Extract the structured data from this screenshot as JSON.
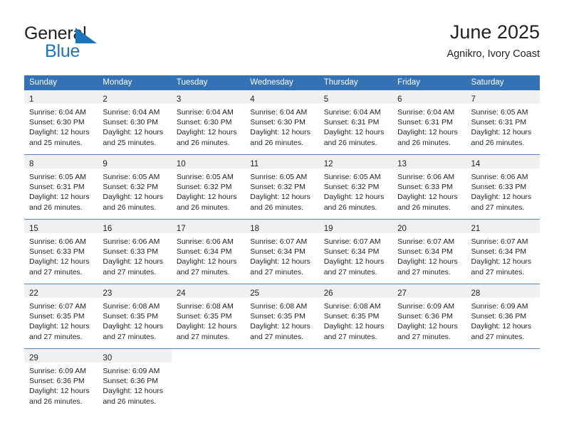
{
  "brand": {
    "name_part1": "General",
    "name_part2": "Blue",
    "flag_color": "#1b75bb"
  },
  "header": {
    "title": "June 2025",
    "subtitle": "Agnikro, Ivory Coast"
  },
  "theme": {
    "header_bg": "#3372b5",
    "daynum_band_bg": "#f0f0f0",
    "grid_line": "#4f85c0",
    "text": "#231f20"
  },
  "weekdays": [
    "Sunday",
    "Monday",
    "Tuesday",
    "Wednesday",
    "Thursday",
    "Friday",
    "Saturday"
  ],
  "weeks": [
    [
      {
        "day": "1",
        "sunrise": "Sunrise: 6:04 AM",
        "sunset": "Sunset: 6:30 PM",
        "daylight1": "Daylight: 12 hours",
        "daylight2": "and 25 minutes."
      },
      {
        "day": "2",
        "sunrise": "Sunrise: 6:04 AM",
        "sunset": "Sunset: 6:30 PM",
        "daylight1": "Daylight: 12 hours",
        "daylight2": "and 25 minutes."
      },
      {
        "day": "3",
        "sunrise": "Sunrise: 6:04 AM",
        "sunset": "Sunset: 6:30 PM",
        "daylight1": "Daylight: 12 hours",
        "daylight2": "and 26 minutes."
      },
      {
        "day": "4",
        "sunrise": "Sunrise: 6:04 AM",
        "sunset": "Sunset: 6:30 PM",
        "daylight1": "Daylight: 12 hours",
        "daylight2": "and 26 minutes."
      },
      {
        "day": "5",
        "sunrise": "Sunrise: 6:04 AM",
        "sunset": "Sunset: 6:31 PM",
        "daylight1": "Daylight: 12 hours",
        "daylight2": "and 26 minutes."
      },
      {
        "day": "6",
        "sunrise": "Sunrise: 6:04 AM",
        "sunset": "Sunset: 6:31 PM",
        "daylight1": "Daylight: 12 hours",
        "daylight2": "and 26 minutes."
      },
      {
        "day": "7",
        "sunrise": "Sunrise: 6:05 AM",
        "sunset": "Sunset: 6:31 PM",
        "daylight1": "Daylight: 12 hours",
        "daylight2": "and 26 minutes."
      }
    ],
    [
      {
        "day": "8",
        "sunrise": "Sunrise: 6:05 AM",
        "sunset": "Sunset: 6:31 PM",
        "daylight1": "Daylight: 12 hours",
        "daylight2": "and 26 minutes."
      },
      {
        "day": "9",
        "sunrise": "Sunrise: 6:05 AM",
        "sunset": "Sunset: 6:32 PM",
        "daylight1": "Daylight: 12 hours",
        "daylight2": "and 26 minutes."
      },
      {
        "day": "10",
        "sunrise": "Sunrise: 6:05 AM",
        "sunset": "Sunset: 6:32 PM",
        "daylight1": "Daylight: 12 hours",
        "daylight2": "and 26 minutes."
      },
      {
        "day": "11",
        "sunrise": "Sunrise: 6:05 AM",
        "sunset": "Sunset: 6:32 PM",
        "daylight1": "Daylight: 12 hours",
        "daylight2": "and 26 minutes."
      },
      {
        "day": "12",
        "sunrise": "Sunrise: 6:05 AM",
        "sunset": "Sunset: 6:32 PM",
        "daylight1": "Daylight: 12 hours",
        "daylight2": "and 26 minutes."
      },
      {
        "day": "13",
        "sunrise": "Sunrise: 6:06 AM",
        "sunset": "Sunset: 6:33 PM",
        "daylight1": "Daylight: 12 hours",
        "daylight2": "and 26 minutes."
      },
      {
        "day": "14",
        "sunrise": "Sunrise: 6:06 AM",
        "sunset": "Sunset: 6:33 PM",
        "daylight1": "Daylight: 12 hours",
        "daylight2": "and 27 minutes."
      }
    ],
    [
      {
        "day": "15",
        "sunrise": "Sunrise: 6:06 AM",
        "sunset": "Sunset: 6:33 PM",
        "daylight1": "Daylight: 12 hours",
        "daylight2": "and 27 minutes."
      },
      {
        "day": "16",
        "sunrise": "Sunrise: 6:06 AM",
        "sunset": "Sunset: 6:33 PM",
        "daylight1": "Daylight: 12 hours",
        "daylight2": "and 27 minutes."
      },
      {
        "day": "17",
        "sunrise": "Sunrise: 6:06 AM",
        "sunset": "Sunset: 6:34 PM",
        "daylight1": "Daylight: 12 hours",
        "daylight2": "and 27 minutes."
      },
      {
        "day": "18",
        "sunrise": "Sunrise: 6:07 AM",
        "sunset": "Sunset: 6:34 PM",
        "daylight1": "Daylight: 12 hours",
        "daylight2": "and 27 minutes."
      },
      {
        "day": "19",
        "sunrise": "Sunrise: 6:07 AM",
        "sunset": "Sunset: 6:34 PM",
        "daylight1": "Daylight: 12 hours",
        "daylight2": "and 27 minutes."
      },
      {
        "day": "20",
        "sunrise": "Sunrise: 6:07 AM",
        "sunset": "Sunset: 6:34 PM",
        "daylight1": "Daylight: 12 hours",
        "daylight2": "and 27 minutes."
      },
      {
        "day": "21",
        "sunrise": "Sunrise: 6:07 AM",
        "sunset": "Sunset: 6:34 PM",
        "daylight1": "Daylight: 12 hours",
        "daylight2": "and 27 minutes."
      }
    ],
    [
      {
        "day": "22",
        "sunrise": "Sunrise: 6:07 AM",
        "sunset": "Sunset: 6:35 PM",
        "daylight1": "Daylight: 12 hours",
        "daylight2": "and 27 minutes."
      },
      {
        "day": "23",
        "sunrise": "Sunrise: 6:08 AM",
        "sunset": "Sunset: 6:35 PM",
        "daylight1": "Daylight: 12 hours",
        "daylight2": "and 27 minutes."
      },
      {
        "day": "24",
        "sunrise": "Sunrise: 6:08 AM",
        "sunset": "Sunset: 6:35 PM",
        "daylight1": "Daylight: 12 hours",
        "daylight2": "and 27 minutes."
      },
      {
        "day": "25",
        "sunrise": "Sunrise: 6:08 AM",
        "sunset": "Sunset: 6:35 PM",
        "daylight1": "Daylight: 12 hours",
        "daylight2": "and 27 minutes."
      },
      {
        "day": "26",
        "sunrise": "Sunrise: 6:08 AM",
        "sunset": "Sunset: 6:35 PM",
        "daylight1": "Daylight: 12 hours",
        "daylight2": "and 27 minutes."
      },
      {
        "day": "27",
        "sunrise": "Sunrise: 6:09 AM",
        "sunset": "Sunset: 6:36 PM",
        "daylight1": "Daylight: 12 hours",
        "daylight2": "and 27 minutes."
      },
      {
        "day": "28",
        "sunrise": "Sunrise: 6:09 AM",
        "sunset": "Sunset: 6:36 PM",
        "daylight1": "Daylight: 12 hours",
        "daylight2": "and 27 minutes."
      }
    ],
    [
      {
        "day": "29",
        "sunrise": "Sunrise: 6:09 AM",
        "sunset": "Sunset: 6:36 PM",
        "daylight1": "Daylight: 12 hours",
        "daylight2": "and 26 minutes."
      },
      {
        "day": "30",
        "sunrise": "Sunrise: 6:09 AM",
        "sunset": "Sunset: 6:36 PM",
        "daylight1": "Daylight: 12 hours",
        "daylight2": "and 26 minutes."
      },
      null,
      null,
      null,
      null,
      null
    ]
  ]
}
